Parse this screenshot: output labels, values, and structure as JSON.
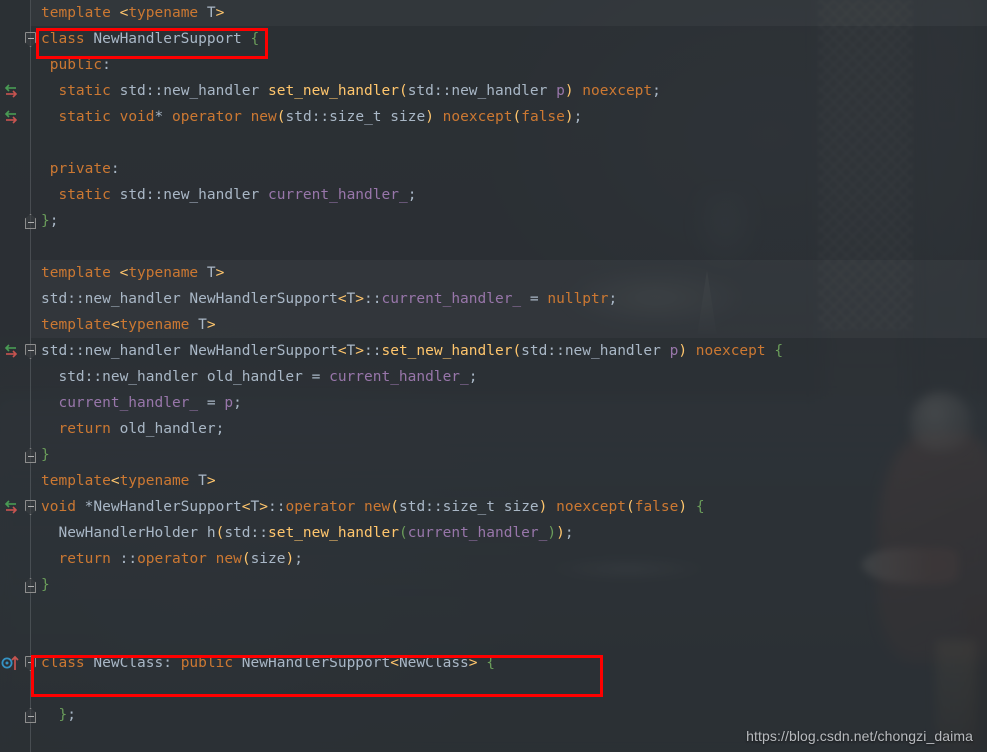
{
  "editor": {
    "theme": "darcula",
    "language": "C++",
    "background_color": "#2b2f33",
    "gutter_color": "#313539",
    "default_text_color": "#a9b7c6",
    "colors": {
      "keyword": "#cc7832",
      "function": "#ffc66d",
      "field": "#9876aa",
      "parameter": "#9876aa",
      "brace": "#6a9c5a",
      "identifier": "#a9b7c6",
      "annotation_box": "#ff0000"
    }
  },
  "watermark": {
    "text": "https://blog.csdn.net/chongzi_daima"
  },
  "annotations": [
    {
      "name": "class-declaration-highlight",
      "label": "class NewHandlerSupport {"
    },
    {
      "name": "derived-class-highlight",
      "label": "class NewClass: public NewHandlerSupport<NewClass> {"
    }
  ],
  "gutter_icons": [
    {
      "name": "fold-start-icon",
      "line": 2,
      "kind": "fold-start"
    },
    {
      "name": "implemented-method-icon",
      "line": 4,
      "kind": "override-arrows"
    },
    {
      "name": "implemented-method-icon",
      "line": 5,
      "kind": "override-arrows"
    },
    {
      "name": "fold-end-icon",
      "line": 9,
      "kind": "fold-end"
    },
    {
      "name": "implemented-method-icon",
      "line": 14,
      "kind": "override-arrows"
    },
    {
      "name": "fold-start-icon",
      "line": 14,
      "kind": "fold-start"
    },
    {
      "name": "fold-end-icon",
      "line": 18,
      "kind": "fold-end"
    },
    {
      "name": "implemented-method-icon",
      "line": 20,
      "kind": "override-arrows"
    },
    {
      "name": "fold-start-icon",
      "line": 20,
      "kind": "fold-start"
    },
    {
      "name": "fold-end-icon",
      "line": 23,
      "kind": "fold-end"
    },
    {
      "name": "subclass-inheritance-icon",
      "line": 26,
      "kind": "inherit-up"
    },
    {
      "name": "fold-start-icon",
      "line": 26,
      "kind": "fold-start"
    },
    {
      "name": "fold-end-icon",
      "line": 28,
      "kind": "fold-end"
    }
  ],
  "code": {
    "lines": [
      {
        "n": 1,
        "tokens": [
          {
            "t": "template ",
            "c": "kw"
          },
          {
            "t": "<",
            "c": "ang"
          },
          {
            "t": "typename",
            "c": "kw"
          },
          {
            "t": " T",
            "c": "id"
          },
          {
            "t": ">",
            "c": "ang"
          }
        ]
      },
      {
        "n": 2,
        "tokens": [
          {
            "t": "class",
            "c": "kw"
          },
          {
            "t": " NewHandlerSupport ",
            "c": "id"
          },
          {
            "t": "{",
            "c": "brc"
          }
        ]
      },
      {
        "n": 3,
        "tokens": [
          {
            "t": " ",
            "c": "id"
          },
          {
            "t": "public",
            "c": "kw"
          },
          {
            "t": ":",
            "c": "id"
          }
        ]
      },
      {
        "n": 4,
        "tokens": [
          {
            "t": "  ",
            "c": "id"
          },
          {
            "t": "static",
            "c": "kw"
          },
          {
            "t": " std::new_handler ",
            "c": "id"
          },
          {
            "t": "set_new_handler",
            "c": "fn"
          },
          {
            "t": "(",
            "c": "par"
          },
          {
            "t": "std::new_handler ",
            "c": "id"
          },
          {
            "t": "p",
            "c": "prm"
          },
          {
            "t": ")",
            "c": "par"
          },
          {
            "t": " ",
            "c": "id"
          },
          {
            "t": "noexcept",
            "c": "kw"
          },
          {
            "t": ";",
            "c": "id"
          }
        ]
      },
      {
        "n": 5,
        "tokens": [
          {
            "t": "  ",
            "c": "id"
          },
          {
            "t": "static",
            "c": "kw"
          },
          {
            "t": " ",
            "c": "id"
          },
          {
            "t": "void",
            "c": "kw"
          },
          {
            "t": "* ",
            "c": "id"
          },
          {
            "t": "operator",
            "c": "kw"
          },
          {
            "t": " ",
            "c": "id"
          },
          {
            "t": "new",
            "c": "kw"
          },
          {
            "t": "(",
            "c": "par"
          },
          {
            "t": "std::size_t size",
            "c": "id"
          },
          {
            "t": ")",
            "c": "par"
          },
          {
            "t": " ",
            "c": "id"
          },
          {
            "t": "noexcept",
            "c": "kw"
          },
          {
            "t": "(",
            "c": "par"
          },
          {
            "t": "false",
            "c": "kw"
          },
          {
            "t": ")",
            "c": "par"
          },
          {
            "t": ";",
            "c": "id"
          }
        ]
      },
      {
        "n": 6,
        "tokens": []
      },
      {
        "n": 7,
        "tokens": [
          {
            "t": " ",
            "c": "id"
          },
          {
            "t": "private",
            "c": "kw"
          },
          {
            "t": ":",
            "c": "id"
          }
        ]
      },
      {
        "n": 8,
        "tokens": [
          {
            "t": "  ",
            "c": "id"
          },
          {
            "t": "static",
            "c": "kw"
          },
          {
            "t": " std::new_handler ",
            "c": "id"
          },
          {
            "t": "current_handler_",
            "c": "fld"
          },
          {
            "t": ";",
            "c": "id"
          }
        ]
      },
      {
        "n": 9,
        "tokens": [
          {
            "t": "}",
            "c": "brc"
          },
          {
            "t": ";",
            "c": "id"
          }
        ]
      },
      {
        "n": 10,
        "tokens": []
      },
      {
        "n": 11,
        "tokens": [
          {
            "t": "template ",
            "c": "kw"
          },
          {
            "t": "<",
            "c": "ang"
          },
          {
            "t": "typename",
            "c": "kw"
          },
          {
            "t": " T",
            "c": "id"
          },
          {
            "t": ">",
            "c": "ang"
          }
        ]
      },
      {
        "n": 12,
        "tokens": [
          {
            "t": "std::new_handler NewHandlerSupport",
            "c": "id"
          },
          {
            "t": "<",
            "c": "ang"
          },
          {
            "t": "T",
            "c": "id"
          },
          {
            "t": ">",
            "c": "ang"
          },
          {
            "t": "::",
            "c": "id"
          },
          {
            "t": "current_handler_",
            "c": "fld"
          },
          {
            "t": " = ",
            "c": "id"
          },
          {
            "t": "nullptr",
            "c": "kw"
          },
          {
            "t": ";",
            "c": "id"
          }
        ]
      },
      {
        "n": 13,
        "tokens": [
          {
            "t": "template",
            "c": "kw"
          },
          {
            "t": "<",
            "c": "ang"
          },
          {
            "t": "typename",
            "c": "kw"
          },
          {
            "t": " T",
            "c": "id"
          },
          {
            "t": ">",
            "c": "ang"
          }
        ]
      },
      {
        "n": 14,
        "tokens": [
          {
            "t": "std::new_handler NewHandlerSupport",
            "c": "id"
          },
          {
            "t": "<",
            "c": "ang"
          },
          {
            "t": "T",
            "c": "id"
          },
          {
            "t": ">",
            "c": "ang"
          },
          {
            "t": "::",
            "c": "id"
          },
          {
            "t": "set_new_handler",
            "c": "fn"
          },
          {
            "t": "(",
            "c": "par"
          },
          {
            "t": "std::new_handler ",
            "c": "id"
          },
          {
            "t": "p",
            "c": "prm"
          },
          {
            "t": ")",
            "c": "par"
          },
          {
            "t": " ",
            "c": "id"
          },
          {
            "t": "noexcept",
            "c": "kw"
          },
          {
            "t": " ",
            "c": "id"
          },
          {
            "t": "{",
            "c": "brc"
          }
        ]
      },
      {
        "n": 15,
        "tokens": [
          {
            "t": "  std::new_handler old_handler = ",
            "c": "id"
          },
          {
            "t": "current_handler_",
            "c": "fld"
          },
          {
            "t": ";",
            "c": "id"
          }
        ]
      },
      {
        "n": 16,
        "tokens": [
          {
            "t": "  ",
            "c": "id"
          },
          {
            "t": "current_handler_",
            "c": "fld"
          },
          {
            "t": " = ",
            "c": "id"
          },
          {
            "t": "p",
            "c": "prm"
          },
          {
            "t": ";",
            "c": "id"
          }
        ]
      },
      {
        "n": 17,
        "tokens": [
          {
            "t": "  ",
            "c": "id"
          },
          {
            "t": "return",
            "c": "kw"
          },
          {
            "t": " old_handler;",
            "c": "id"
          }
        ]
      },
      {
        "n": 18,
        "tokens": [
          {
            "t": "}",
            "c": "brc"
          }
        ]
      },
      {
        "n": 19,
        "tokens": [
          {
            "t": "template",
            "c": "kw"
          },
          {
            "t": "<",
            "c": "ang"
          },
          {
            "t": "typename",
            "c": "kw"
          },
          {
            "t": " T",
            "c": "id"
          },
          {
            "t": ">",
            "c": "ang"
          }
        ]
      },
      {
        "n": 20,
        "tokens": [
          {
            "t": "void",
            "c": "kw"
          },
          {
            "t": " *NewHandlerSupport",
            "c": "id"
          },
          {
            "t": "<",
            "c": "ang"
          },
          {
            "t": "T",
            "c": "id"
          },
          {
            "t": ">",
            "c": "ang"
          },
          {
            "t": "::",
            "c": "id"
          },
          {
            "t": "operator",
            "c": "kw"
          },
          {
            "t": " ",
            "c": "id"
          },
          {
            "t": "new",
            "c": "kw"
          },
          {
            "t": "(",
            "c": "par"
          },
          {
            "t": "std::size_t size",
            "c": "id"
          },
          {
            "t": ")",
            "c": "par"
          },
          {
            "t": " ",
            "c": "id"
          },
          {
            "t": "noexcept",
            "c": "kw"
          },
          {
            "t": "(",
            "c": "par"
          },
          {
            "t": "false",
            "c": "kw"
          },
          {
            "t": ")",
            "c": "par"
          },
          {
            "t": " ",
            "c": "id"
          },
          {
            "t": "{",
            "c": "brc"
          }
        ]
      },
      {
        "n": 21,
        "tokens": [
          {
            "t": "  NewHandlerHolder h",
            "c": "id"
          },
          {
            "t": "(",
            "c": "par"
          },
          {
            "t": "std::",
            "c": "id"
          },
          {
            "t": "set_new_handler",
            "c": "fn"
          },
          {
            "t": "(",
            "c": "brc"
          },
          {
            "t": "current_handler_",
            "c": "fld"
          },
          {
            "t": ")",
            "c": "brc"
          },
          {
            "t": ")",
            "c": "par"
          },
          {
            "t": ";",
            "c": "id"
          }
        ]
      },
      {
        "n": 22,
        "tokens": [
          {
            "t": "  ",
            "c": "id"
          },
          {
            "t": "return",
            "c": "kw"
          },
          {
            "t": " ::",
            "c": "id"
          },
          {
            "t": "operator",
            "c": "kw"
          },
          {
            "t": " ",
            "c": "id"
          },
          {
            "t": "new",
            "c": "kw"
          },
          {
            "t": "(",
            "c": "par"
          },
          {
            "t": "size",
            "c": "id"
          },
          {
            "t": ")",
            "c": "par"
          },
          {
            "t": ";",
            "c": "id"
          }
        ]
      },
      {
        "n": 23,
        "tokens": [
          {
            "t": "}",
            "c": "brc"
          }
        ]
      },
      {
        "n": 24,
        "tokens": []
      },
      {
        "n": 25,
        "tokens": []
      },
      {
        "n": 26,
        "tokens": [
          {
            "t": "class",
            "c": "kw"
          },
          {
            "t": " NewClass: ",
            "c": "id"
          },
          {
            "t": "public",
            "c": "kw"
          },
          {
            "t": " NewHandlerSupport",
            "c": "id"
          },
          {
            "t": "<",
            "c": "ang"
          },
          {
            "t": "NewClass",
            "c": "id"
          },
          {
            "t": ">",
            "c": "ang"
          },
          {
            "t": " ",
            "c": "id"
          },
          {
            "t": "{",
            "c": "brc"
          }
        ]
      },
      {
        "n": 27,
        "tokens": []
      },
      {
        "n": 28,
        "tokens": [
          {
            "t": "  ",
            "c": "id"
          },
          {
            "t": "}",
            "c": "brc"
          },
          {
            "t": ";",
            "c": "id"
          }
        ]
      }
    ]
  }
}
